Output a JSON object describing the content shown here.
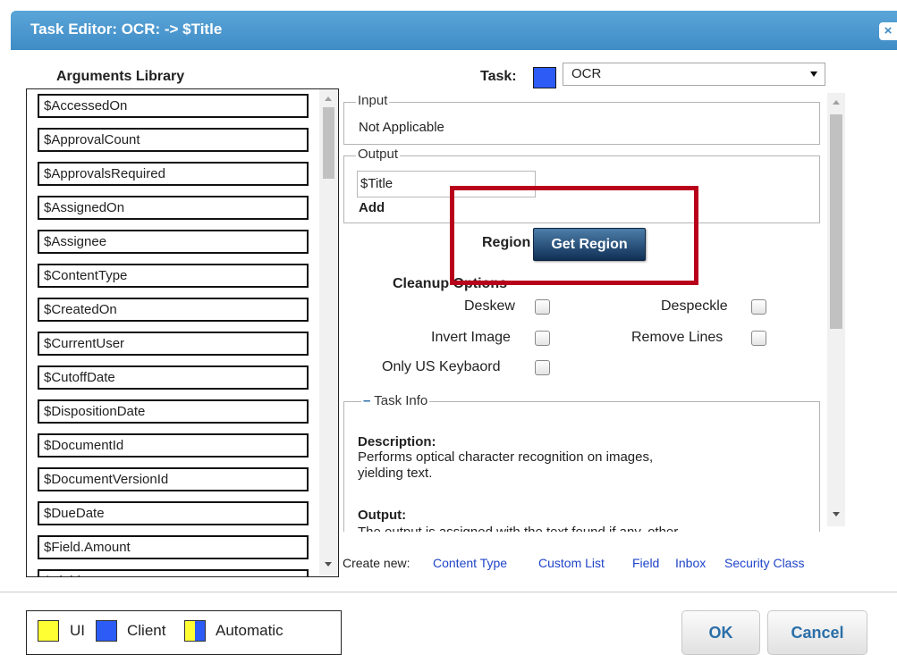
{
  "window": {
    "title": "Task Editor:  OCR: -> $Title",
    "close_glyph": "×"
  },
  "library": {
    "title": "Arguments Library",
    "items": [
      "$AccessedOn",
      "$ApprovalCount",
      "$ApprovalsRequired",
      "$AssignedOn",
      "$Assignee",
      "$ContentType",
      "$CreatedOn",
      "$CurrentUser",
      "$CutoffDate",
      "$DispositionDate",
      "$DocumentId",
      "$DocumentVersionId",
      "$DueDate",
      "$Field.Amount",
      "$Field.Approver"
    ]
  },
  "task": {
    "label": "Task:",
    "swatch_color": "#2c5cf5",
    "selected": "OCR"
  },
  "input_section": {
    "legend": "Input",
    "value": "Not Applicable"
  },
  "output_section": {
    "legend": "Output",
    "field_value": "$Title",
    "add_label": "Add"
  },
  "region": {
    "label": "Region",
    "button_label": "Get Region",
    "highlight_color": "#b8001b"
  },
  "cleanup": {
    "title": "Cleanup Options",
    "options": [
      {
        "label": "Deskew",
        "checked": false
      },
      {
        "label": "Despeckle",
        "checked": false
      },
      {
        "label": "Invert Image",
        "checked": false
      },
      {
        "label": "Remove Lines",
        "checked": false
      },
      {
        "label": "Only US Keybaord",
        "checked": false
      }
    ]
  },
  "task_info": {
    "toggle": "–",
    "legend": "Task Info",
    "description_label": "Description:",
    "description_line1": "Performs optical character recognition on images,",
    "description_line2": "yielding text.",
    "output_label": "Output:",
    "output_partial": "The output is assigned with the text found if any, other"
  },
  "create_new": {
    "label": "Create new:",
    "links": [
      "Content Type",
      "Custom List",
      "Field",
      "Inbox",
      "Security Class"
    ]
  },
  "legend_bar": {
    "items": [
      {
        "label": "UI",
        "color": "#ffff33"
      },
      {
        "label": "Client",
        "color": "#2c5cf5"
      },
      {
        "label": "Automatic",
        "color": "split"
      }
    ]
  },
  "buttons": {
    "ok": "OK",
    "cancel": "Cancel"
  }
}
